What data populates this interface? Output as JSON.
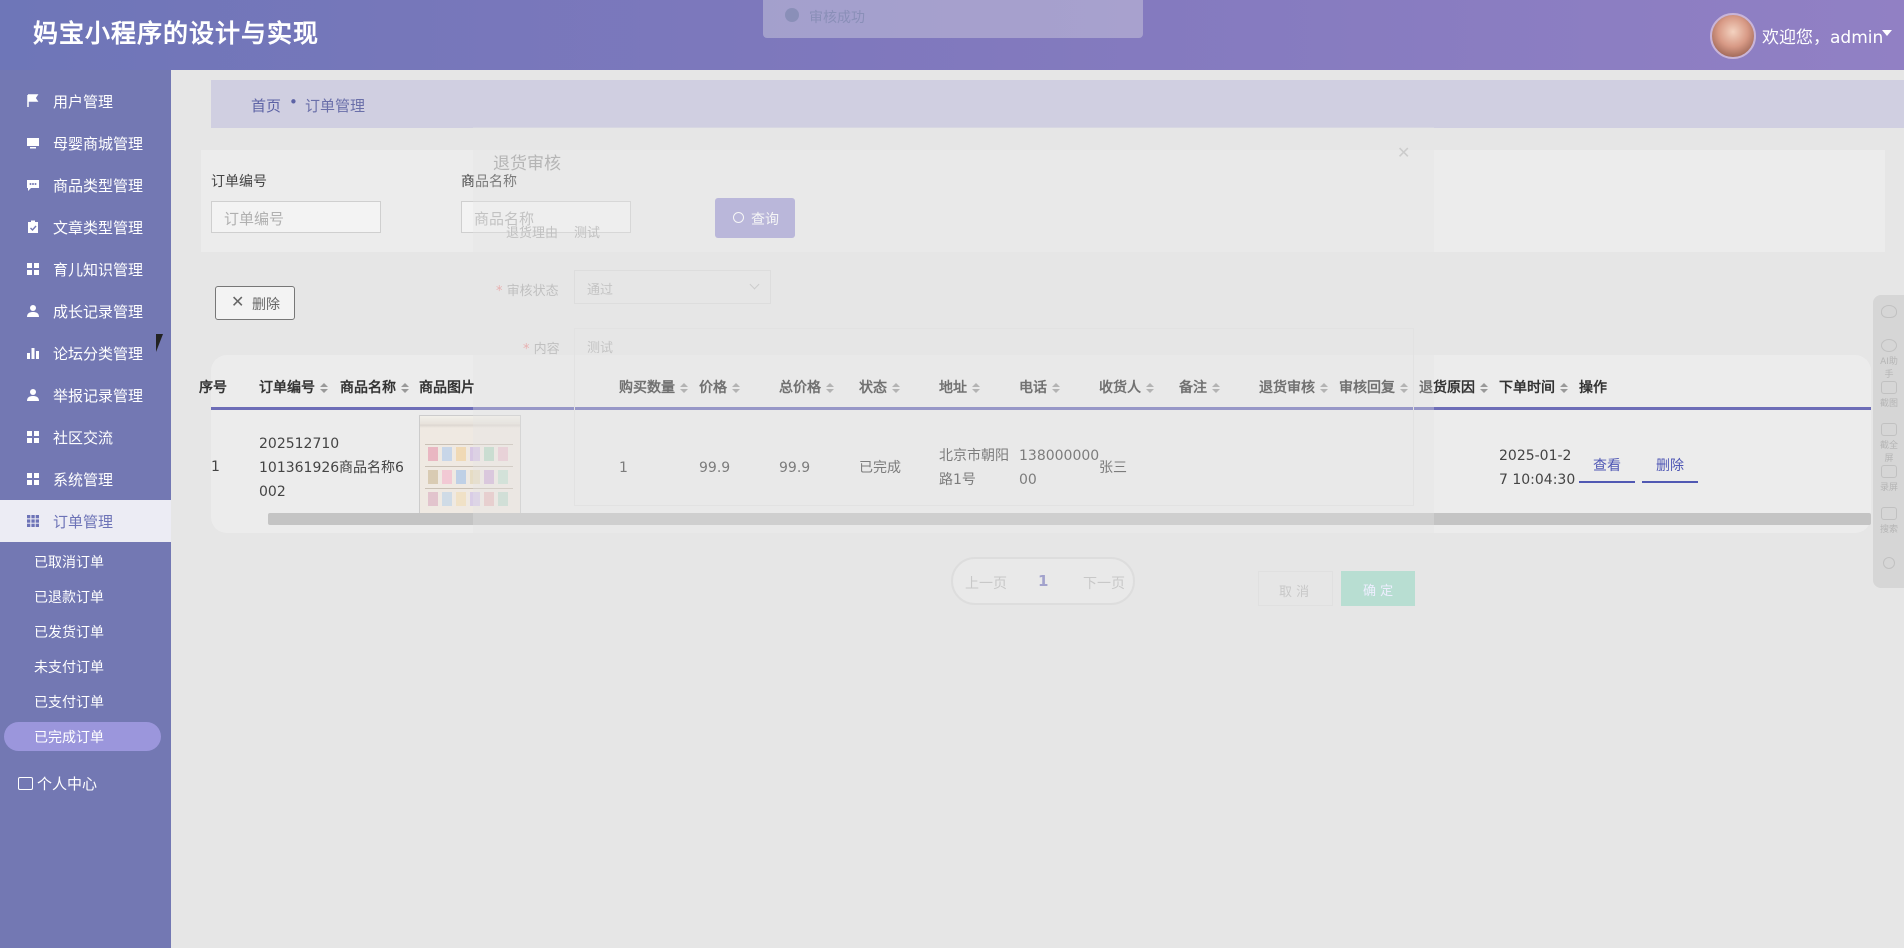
{
  "app": {
    "title": "妈宝小程序的设计与实现"
  },
  "toast": {
    "text": "审核成功"
  },
  "user": {
    "welcome": "欢迎您，admin"
  },
  "sidebar": {
    "items": [
      {
        "label": "用户管理",
        "icon": "flag-icon"
      },
      {
        "label": "母婴商城管理",
        "icon": "monitor-icon"
      },
      {
        "label": "商品类型管理",
        "icon": "chat-icon"
      },
      {
        "label": "文章类型管理",
        "icon": "clipboard-icon"
      },
      {
        "label": "育儿知识管理",
        "icon": "grid-icon"
      },
      {
        "label": "成长记录管理",
        "icon": "user-icon"
      },
      {
        "label": "论坛分类管理",
        "icon": "bar-chart-icon"
      },
      {
        "label": "举报记录管理",
        "icon": "user-icon"
      },
      {
        "label": "社区交流",
        "icon": "grid-icon"
      },
      {
        "label": "系统管理",
        "icon": "grid-icon"
      },
      {
        "label": "订单管理",
        "icon": "grid-icon"
      }
    ],
    "sub_items": [
      "已取消订单",
      "已退款订单",
      "已发货订单",
      "未支付订单",
      "已支付订单",
      "已完成订单"
    ],
    "profile": "个人中心"
  },
  "breadcrumb": {
    "home": "首页",
    "separator": "•",
    "current": "订单管理"
  },
  "search": {
    "order_no_label": "订单编号",
    "order_no_placeholder": "订单编号",
    "product_label": "商品名称",
    "product_placeholder": "商品名称",
    "query_label": "查询"
  },
  "toolbar": {
    "delete_label": "删除"
  },
  "table": {
    "headers": {
      "seq": "序号",
      "order_no": "订单编号",
      "product_name": "商品名称",
      "product_image": "商品图片",
      "quantity": "购买数量",
      "price": "价格",
      "total": "总价格",
      "status": "状态",
      "address": "地址",
      "phone": "电话",
      "receiver": "收货人",
      "remark": "备注",
      "return_review": "退货审核",
      "review_reply": "审核回复",
      "return_reason": "退货原因",
      "order_time": "下单时间",
      "actions": "操作"
    },
    "row": {
      "seq": "1",
      "order_no_l1": "202512710",
      "order_no_l2": "101361926",
      "order_no_l3": "002",
      "product_name": "商品名称6",
      "quantity": "1",
      "price": "99.9",
      "total": "99.9",
      "status": "已完成",
      "address_l1": "北京市朝阳",
      "address_l2": "路1号",
      "phone_l1": "138000000",
      "phone_l2": "00",
      "receiver": "张三",
      "time_l1": "2025-01-2",
      "time_l2": "7 10:04:30",
      "view_label": "查看",
      "delete_label": "删除"
    }
  },
  "pager": {
    "prev": "上一页",
    "page": "1",
    "next": "下一页"
  },
  "modal": {
    "title": "退货审核",
    "reason_label": "退货理由",
    "reason_value": "测试",
    "status_label": "审核状态",
    "status_value": "通过",
    "content_label": "内容",
    "content_value": "测试",
    "cancel_label": "取 消",
    "confirm_label": "确 定"
  },
  "rightbar": {
    "items": [
      "AI助手",
      "截图",
      "截全屏",
      "录屏",
      "搜索"
    ]
  },
  "colors": {
    "header": "#7f78bd",
    "sidebar": "#7378b3",
    "accent": "#6d6db7",
    "active_sub": "#9b96dc"
  }
}
